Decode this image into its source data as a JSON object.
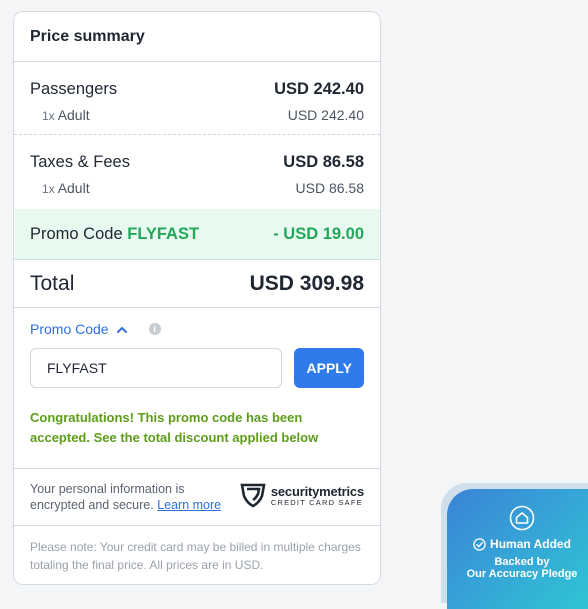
{
  "summary": {
    "title": "Price summary",
    "passengers": {
      "label": "Passengers",
      "amount": "USD 242.40",
      "qty": "1x",
      "type": "Adult",
      "sub_amount": "USD 242.40"
    },
    "taxes": {
      "label": "Taxes & Fees",
      "amount": "USD 86.58",
      "qty": "1x",
      "type": "Adult",
      "sub_amount": "USD 86.58"
    },
    "promo": {
      "label": "Promo Code",
      "code": "FLYFAST",
      "discount": "- USD 19.00"
    },
    "total": {
      "label": "Total",
      "amount": "USD 309.98"
    }
  },
  "promo_form": {
    "toggle_label": "Promo Code",
    "input_value": "FLYFAST",
    "apply_label": "APPLY",
    "success_message": "Congratulations! This promo code has been accepted. See the total discount applied below"
  },
  "security": {
    "text": "Your personal information is encrypted and secure.",
    "link": "Learn more",
    "logo_name": "securitymetrics",
    "logo_sub": "CREDIT CARD SAFE"
  },
  "note": "Please note: Your credit card may be billed in multiple charges totaling the final price. All prices are in USD.",
  "badge": {
    "title": "Human Added",
    "line1": "Backed by",
    "line2": "Our Accuracy Pledge"
  },
  "colors": {
    "accent": "#2f7bec",
    "success": "#22a85a",
    "message": "#5e9d1a"
  }
}
